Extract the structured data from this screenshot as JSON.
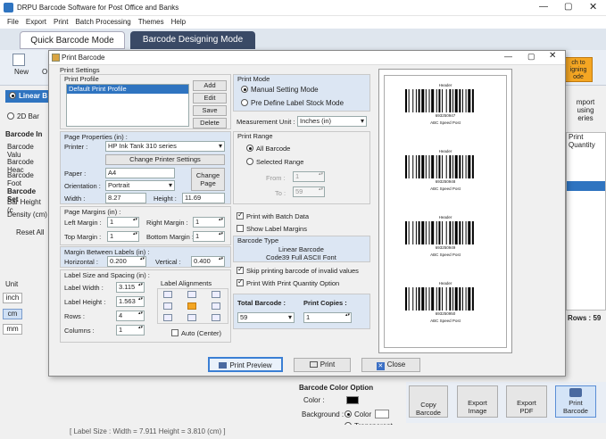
{
  "app": {
    "title": "DRPU Barcode Software for Post Office and Banks"
  },
  "menu": [
    "File",
    "Export",
    "Print",
    "Batch Processing",
    "Themes",
    "Help"
  ],
  "tabs": {
    "quick": "Quick Barcode Mode",
    "designing": "Barcode Designing Mode"
  },
  "ribbon": {
    "new": "New",
    "op": "O",
    "batch_line1": "ch to",
    "batch_line2": "igning",
    "batch_line3": "ode"
  },
  "left_panel": {
    "linear": "Linear B",
    "twod": "2D Bar",
    "barcode_in": "Barcode In",
    "barcode_value": "Barcode Valu",
    "barcode_header": "Barcode Heac",
    "barcode_footer": "Barcode Foot",
    "barcode_settings": "Barcode Set",
    "bar_height": "Bar Height (c",
    "density": "Density (cm)",
    "reset_all": "Reset All",
    "unit": "Unit",
    "inch": "inch",
    "cm": "cm",
    "mm": "mm"
  },
  "right_panel": {
    "import_line1": "mport",
    "import_line2": "using",
    "import_line3": "eries",
    "print_col": "Print",
    "quantity_col": "Quantity",
    "rows": "Rows : 59"
  },
  "dialog": {
    "title": "Print Barcode",
    "print_settings": "Print Settings",
    "print_profile": "Print Profile",
    "profile_item": "Default Print Profile",
    "add": "Add",
    "edit": "Edit",
    "save": "Save",
    "delete": "Delete",
    "page_properties": "Page Properties (in) :",
    "printer_label": "Printer :",
    "printer_value": "HP Ink Tank 310 series",
    "change_printer": "Change Printer Settings",
    "paper_label": "Paper :",
    "paper_value": "A4",
    "orientation_label": "Orientation :",
    "orientation_value": "Portrait",
    "change_page_line1": "Change",
    "change_page_line2": "Page",
    "width_label": "Width :",
    "width_value": "8.27",
    "height_label": "Height :",
    "height_value": "11.69",
    "page_margins": "Page Margins (in) :",
    "left_margin": "Left Margin :",
    "left_margin_value": "1",
    "right_margin": "Right Margin :",
    "right_margin_value": "1",
    "top_margin": "Top Margin :",
    "top_margin_value": "1",
    "bottom_margin": "Bottom Margin :",
    "bottom_margin_value": "1",
    "margin_between": "Margin Between Labels (in) :",
    "horizontal": "Horizontal :",
    "horizontal_value": "0.200",
    "vertical": "Vertical :",
    "vertical_value": "0.400",
    "label_size": "Label Size and Spacing (in) :",
    "label_width": "Label Width :",
    "label_width_value": "3.115",
    "label_height": "Label Height :",
    "label_height_value": "1.563",
    "rows": "Rows :",
    "rows_value": "4",
    "columns": "Columns :",
    "columns_value": "1",
    "label_alignments": "Label Alignments",
    "auto_center": "Auto (Center)",
    "print_mode": "Print Mode",
    "manual": "Manual Setting Mode",
    "predefine": "Pre Define Label Stock Mode",
    "measurement_label": "Measurement Unit :",
    "measurement_value": "Inches (in)",
    "print_range": "Print Range",
    "all_barcode": "All Barcode",
    "selected_range": "Selected Range",
    "from": "From :",
    "from_value": "1",
    "to": "To :",
    "to_value": "59",
    "print_batch": "Print with Batch Data",
    "show_margins": "Show Label Margins",
    "barcode_type": "Barcode Type",
    "barcode_type_line1": "Linear Barcode",
    "barcode_type_line2": "Code39 Full ASCII Font",
    "skip_invalid": "Skip printing barcode of invalid values",
    "print_quantity": "Print With Print Quantity Option",
    "total_barcode": "Total Barcode :",
    "total_value": "59",
    "print_copies": "Print Copies :",
    "copies_value": "1",
    "print_preview": "Print Preview",
    "print": "Print",
    "close": "Close"
  },
  "preview_labels": [
    {
      "header": "Header",
      "number": "693250947",
      "footer": "ABC Speed Post"
    },
    {
      "header": "Header",
      "number": "693250948",
      "footer": "ABC Speed Post"
    },
    {
      "header": "Header",
      "number": "693250949",
      "footer": "ABC Speed Post"
    },
    {
      "header": "Header",
      "number": "693250950",
      "footer": "ABC Speed Post"
    }
  ],
  "bottom": {
    "color_option": "Barcode Color Option",
    "color": "Color :",
    "background": "Background :",
    "bg_color": "Color",
    "bg_transparent": "Transparent",
    "copy_barcode_1": "Copy",
    "copy_barcode_2": "Barcode",
    "export_image_1": "Export",
    "export_image_2": "Image",
    "export_pdf_1": "Export",
    "export_pdf_2": "PDF",
    "print_barcode_1": "Print",
    "print_barcode_2": "Barcode",
    "status": "[ Label Size : Width = 7.911  Height = 3.810 (cm) ]"
  }
}
